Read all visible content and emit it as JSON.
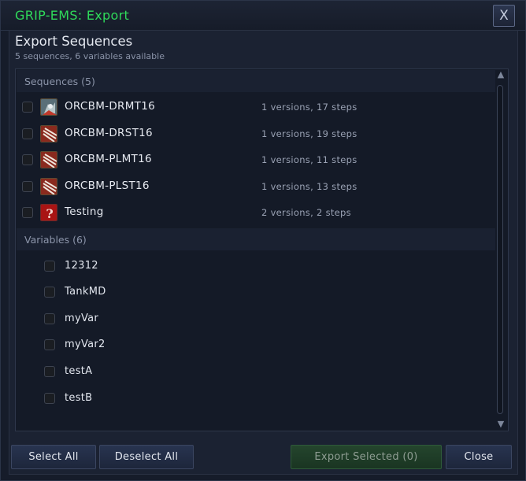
{
  "window": {
    "title": "GRIP-EMS: Export",
    "close_label": "X"
  },
  "dialog": {
    "heading": "Export Sequences",
    "subheading": "5 sequences, 6 variables available"
  },
  "sequences_section": {
    "label": "Sequences (5)",
    "items": [
      {
        "name": "ORCBM-DRMT16",
        "info": "1 versions, 17 steps",
        "icon": "warrior-ability-icon"
      },
      {
        "name": "ORCBM-DRST16",
        "info": "1 versions, 19 steps",
        "icon": "claw-slash-icon"
      },
      {
        "name": "ORCBM-PLMT16",
        "info": "1 versions, 11 steps",
        "icon": "claw-slash-icon"
      },
      {
        "name": "ORCBM-PLST16",
        "info": "1 versions, 13 steps",
        "icon": "claw-slash-icon"
      },
      {
        "name": "Testing",
        "info": "2 versions, 2 steps",
        "icon": "question-mark-icon"
      }
    ]
  },
  "variables_section": {
    "label": "Variables (6)",
    "items": [
      "12312",
      "TankMD",
      "myVar",
      "myVar2",
      "testA",
      "testB"
    ]
  },
  "buttons": {
    "select_all": "Select All",
    "deselect_all": "Deselect All",
    "export_selected": "Export Selected (0)",
    "close": "Close"
  },
  "colors": {
    "title": "#2fd95a",
    "background": "#161c2a",
    "panel": "#141a27",
    "export_button": "#24452d"
  }
}
